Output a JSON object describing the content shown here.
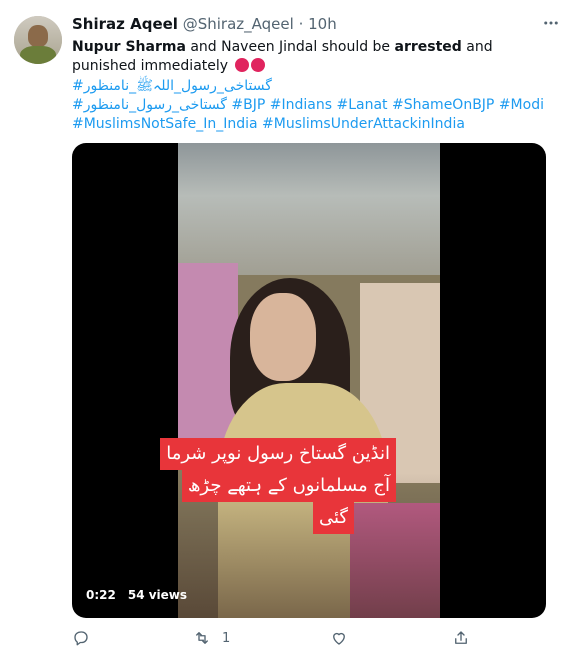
{
  "tweet": {
    "author_name": "Shiraz Aqeel",
    "handle": "@Shiraz_Aqeel",
    "separator": "·",
    "time": "10h",
    "more_icon": "more-icon",
    "text": {
      "part1_bold": "Nupur Sharma",
      "part2": " and Naveen Jindal should be ",
      "part3_bold": "arrested",
      "part4": " and punished immediately"
    },
    "hashtags_line1": "#گستاخی_رسول_اللہﷺ_نامنظور",
    "hashtags_line2": "#گستاخی_رسول_نامنظور #BJP #Indians #Lanat #ShameOnBJP #Modi",
    "hashtags_line3": "#MuslimsNotSafe_In_India #MuslimsUnderAttackinIndia"
  },
  "media": {
    "caption_line1": "انڈین گستاخ رسول نوپر شرما",
    "caption_line2": "آج مسلمانوں کے ہتھے چڑھ",
    "caption_line3": "گئی",
    "duration": "0:22",
    "views": "54 views"
  },
  "actions": {
    "reply_icon": "reply-icon",
    "retweet_icon": "retweet-icon",
    "retweet_count": "1",
    "like_icon": "heart-icon",
    "share_icon": "share-icon"
  },
  "colors": {
    "link": "#1d9bf0",
    "muted": "#536471",
    "caption_bg": "#e8353a"
  }
}
